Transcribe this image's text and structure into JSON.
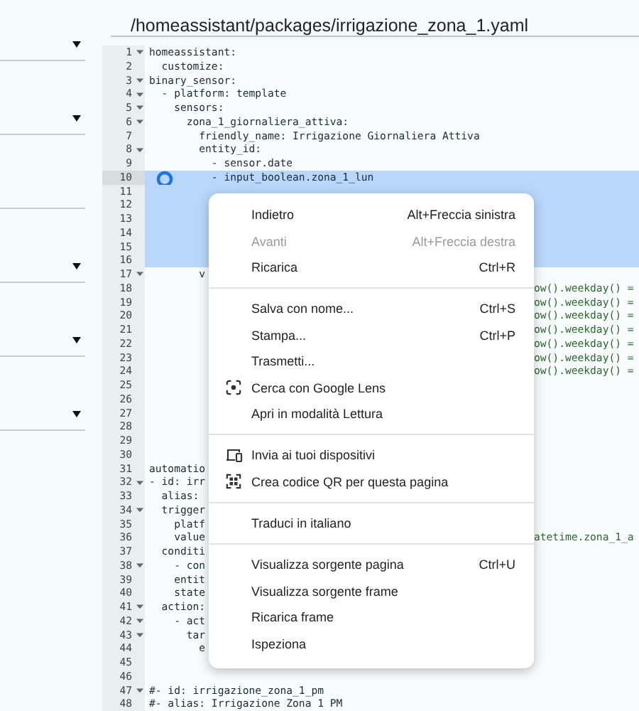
{
  "sidebar": {
    "rows": [
      {
        "expandable": true
      },
      {
        "expandable": true
      },
      {
        "expandable": false
      },
      {
        "expandable": true
      },
      {
        "expandable": true
      },
      {
        "expandable": true
      }
    ]
  },
  "file_path": "/homeassistant/packages/irrigazione_zona_1.yaml",
  "editor": {
    "lines": [
      {
        "number": "1",
        "fold": true,
        "text": "homeassistant:",
        "selected": false,
        "active": false
      },
      {
        "number": "2",
        "fold": false,
        "text": "  customize:",
        "selected": false,
        "active": false
      },
      {
        "number": "3",
        "fold": true,
        "text": "binary_sensor:",
        "selected": false,
        "active": false
      },
      {
        "number": "4",
        "fold": true,
        "text": "  - platform: template",
        "selected": false,
        "active": false
      },
      {
        "number": "5",
        "fold": true,
        "text": "    sensors:",
        "selected": false,
        "active": false
      },
      {
        "number": "6",
        "fold": true,
        "text": "      zona_1_giornaliera_attiva:",
        "selected": false,
        "active": false
      },
      {
        "number": "7",
        "fold": false,
        "text": "        friendly_name: Irrigazione Giornaliera Attiva",
        "selected": false,
        "active": false
      },
      {
        "number": "8",
        "fold": true,
        "text": "        entity_id:",
        "selected": false,
        "active": false
      },
      {
        "number": "9",
        "fold": false,
        "text": "          - sensor.date",
        "selected": false,
        "active": false
      },
      {
        "number": "10",
        "fold": false,
        "text": "          - input_boolean.zona_1_lun",
        "selected": true,
        "active": true
      },
      {
        "number": "11",
        "fold": false,
        "selected": true,
        "active": false
      },
      {
        "number": "12",
        "fold": false,
        "selected": true,
        "active": false
      },
      {
        "number": "13",
        "fold": false,
        "selected": true,
        "active": false
      },
      {
        "number": "14",
        "fold": false,
        "selected": true,
        "active": false
      },
      {
        "number": "15",
        "fold": false,
        "selected": true,
        "active": false
      },
      {
        "number": "16",
        "fold": false,
        "selected": true,
        "active": false
      },
      {
        "number": "17",
        "fold": true,
        "text": "        v",
        "selected": false,
        "active": false
      },
      {
        "number": "18",
        "fold": false,
        "tail": "ow().weekday() =",
        "selected": false,
        "active": false
      },
      {
        "number": "19",
        "fold": false,
        "tail": "ow().weekday() =",
        "selected": false,
        "active": false
      },
      {
        "number": "20",
        "fold": false,
        "tail": "ow().weekday() =",
        "selected": false,
        "active": false
      },
      {
        "number": "21",
        "fold": false,
        "tail": "ow().weekday() =",
        "selected": false,
        "active": false
      },
      {
        "number": "22",
        "fold": false,
        "tail": "ow().weekday() =",
        "selected": false,
        "active": false
      },
      {
        "number": "23",
        "fold": false,
        "tail": "ow().weekday() =",
        "selected": false,
        "active": false
      },
      {
        "number": "24",
        "fold": false,
        "tail": "ow().weekday() =",
        "selected": false,
        "active": false
      },
      {
        "number": "25",
        "fold": false,
        "selected": false,
        "active": false
      },
      {
        "number": "26",
        "fold": false,
        "selected": false,
        "active": false
      },
      {
        "number": "27",
        "fold": false,
        "selected": false,
        "active": false
      },
      {
        "number": "28",
        "fold": false,
        "selected": false,
        "active": false
      },
      {
        "number": "29",
        "fold": false,
        "selected": false,
        "active": false
      },
      {
        "number": "30",
        "fold": false,
        "selected": false,
        "active": false
      },
      {
        "number": "31",
        "fold": false,
        "text": "automatio",
        "selected": false,
        "active": false
      },
      {
        "number": "32",
        "fold": true,
        "text": "- id: irr",
        "selected": false,
        "active": false
      },
      {
        "number": "33",
        "fold": false,
        "text": "  alias:",
        "selected": false,
        "active": false
      },
      {
        "number": "34",
        "fold": true,
        "text": "  trigger",
        "selected": false,
        "active": false
      },
      {
        "number": "35",
        "fold": false,
        "text": "    platf",
        "selected": false,
        "active": false
      },
      {
        "number": "36",
        "fold": false,
        "text": "    value",
        "tail": "atetime.zona_1_a",
        "selected": false,
        "active": false
      },
      {
        "number": "37",
        "fold": false,
        "text": "  conditi",
        "selected": false,
        "active": false
      },
      {
        "number": "38",
        "fold": true,
        "text": "    - con",
        "selected": false,
        "active": false
      },
      {
        "number": "39",
        "fold": false,
        "text": "    entit",
        "selected": false,
        "active": false
      },
      {
        "number": "40",
        "fold": false,
        "text": "    state",
        "selected": false,
        "active": false
      },
      {
        "number": "41",
        "fold": true,
        "text": "  action:",
        "selected": false,
        "active": false
      },
      {
        "number": "42",
        "fold": true,
        "text": "    - act",
        "selected": false,
        "active": false
      },
      {
        "number": "43",
        "fold": true,
        "text": "      tar",
        "selected": false,
        "active": false
      },
      {
        "number": "44",
        "fold": false,
        "text": "        e",
        "selected": false,
        "active": false
      },
      {
        "number": "45",
        "fold": false,
        "selected": false,
        "active": false
      },
      {
        "number": "46",
        "fold": false,
        "selected": false,
        "active": false
      },
      {
        "number": "47",
        "fold": true,
        "text": "#- id: irrigazione_zona_1_pm",
        "selected": false,
        "active": false
      },
      {
        "number": "48",
        "fold": false,
        "text": "#- alias: Irrigazione Zona 1 PM",
        "selected": false,
        "active": false
      }
    ]
  },
  "context_menu": {
    "groups": [
      [
        {
          "label": "Indietro",
          "shortcut": "Alt+Freccia sinistra",
          "disabled": false
        },
        {
          "label": "Avanti",
          "shortcut": "Alt+Freccia destra",
          "disabled": true
        },
        {
          "label": "Ricarica",
          "shortcut": "Ctrl+R",
          "disabled": false
        }
      ],
      [
        {
          "label": "Salva con nome...",
          "shortcut": "Ctrl+S",
          "disabled": false
        },
        {
          "label": "Stampa...",
          "shortcut": "Ctrl+P",
          "disabled": false
        },
        {
          "label": "Trasmetti...",
          "disabled": false
        },
        {
          "label": "Cerca con Google Lens",
          "disabled": false
        },
        {
          "label": "Apri in modalità Lettura",
          "disabled": false
        }
      ],
      [
        {
          "label": "Invia ai tuoi dispositivi",
          "disabled": false
        },
        {
          "label": "Crea codice QR per questa pagina",
          "disabled": false
        }
      ],
      [
        {
          "label": "Traduci in italiano",
          "disabled": false
        }
      ],
      [
        {
          "label": "Visualizza sorgente pagina",
          "shortcut": "Ctrl+U",
          "disabled": false
        },
        {
          "label": "Visualizza sorgente frame",
          "disabled": false
        },
        {
          "label": "Ricarica frame",
          "disabled": false
        },
        {
          "label": "Ispeziona",
          "disabled": false
        }
      ]
    ]
  }
}
